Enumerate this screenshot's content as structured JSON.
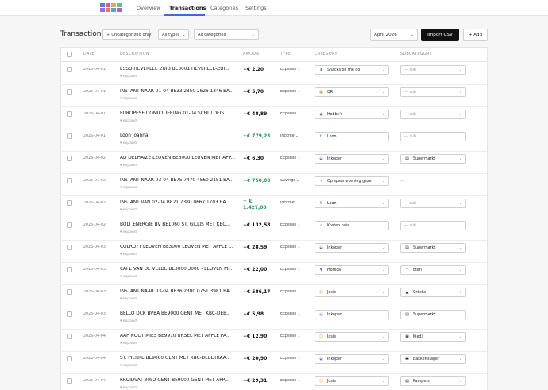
{
  "nav": {
    "logo_colors": [
      "#5b7be0",
      "#e05b7b",
      "#e0a95b",
      "#5bc08c",
      "#9b6be0",
      "#e07b5b",
      "#4aa8d8",
      "#c05bbd"
    ],
    "tabs": [
      {
        "label": "Overview",
        "active": false
      },
      {
        "label": "Transactions",
        "active": true
      },
      {
        "label": "Categories",
        "active": false
      },
      {
        "label": "Settings",
        "active": false
      }
    ]
  },
  "toolbar": {
    "title": "Transactions",
    "uncategorized_label": "Uncategorized only",
    "types_filter": "All types",
    "categories_filter": "All categories",
    "month": "April 2026",
    "import_label": "Import CSV",
    "add_label": "+ Add"
  },
  "table": {
    "headers": {
      "date": "DATE",
      "description": "DESCRIPTION",
      "amount": "AMOUNT",
      "type": "TYPE",
      "category": "CATEGORY",
      "subcategory": "SUBCATEGORY"
    },
    "expand_label": "expand",
    "rows": [
      {
        "date": "2026-04-01",
        "description": "ESSO HEVERLEE ZUID BE3001 HEVERLEE-ZUI...",
        "amount": "−€ 2,20",
        "kind": "expense",
        "type": "Expense",
        "category": "Snacks on the go",
        "category_icon": "bottle-icon",
        "subcategory": "— sub",
        "sub_icon": ""
      },
      {
        "date": "2026-04-01",
        "description": "INSTANT NAAR 01-04 BE33 2350 2626 1346 BA...",
        "amount": "−€ 5,70",
        "kind": "expense",
        "type": "Expense",
        "category": "QR",
        "category_icon": "qr-icon",
        "subcategory": "— sub",
        "sub_icon": ""
      },
      {
        "date": "2026-04-01",
        "description": "EUROPESE DOMICILIERING 01-04 SCHULDEIS...",
        "amount": "−€ 48,89",
        "kind": "expense",
        "type": "Expense",
        "category": "Hobby's",
        "category_icon": "palette-icon",
        "subcategory": "— sub",
        "sub_icon": ""
      },
      {
        "date": "2026-04-01",
        "description": "Loon Joanna",
        "amount": "+€ 779,23",
        "kind": "income",
        "type": "Income",
        "category": "Loon",
        "category_icon": "refresh-icon",
        "subcategory": "— sub",
        "sub_icon": ""
      },
      {
        "date": "2026-04-02",
        "description": "AD DELHAIZE LEUVEN BE3000 LEUVEN MET APP...",
        "amount": "−€ 6,30",
        "kind": "expense",
        "type": "Expense",
        "category": "Inkopen",
        "category_icon": "basket-icon",
        "subcategory": "Supermarkt",
        "sub_icon": "cart-icon"
      },
      {
        "date": "2026-04-02",
        "description": "INSTANT NAAR 03-04 BE75 7470 4560 2151 BA...",
        "amount": "−€ 750,00",
        "kind": "income",
        "type": "Savings",
        "category": "Op spaarrekening gezet",
        "category_icon": "double-chevron-up-icon",
        "subcategory": "—",
        "sub_icon": "",
        "no_sub_select": true
      },
      {
        "date": "2026-04-02",
        "description": "INSTANT VAN 02-04 BE21 7380 0667 1703 BA...",
        "amount": "+\n€ 1.427,00",
        "kind": "income",
        "wrap": true,
        "type": "Income",
        "category": "Loon",
        "category_icon": "refresh-icon",
        "subcategory": "— sub",
        "sub_icon": ""
      },
      {
        "date": "2026-04-02",
        "description": "BOLT ENERGIE BV BE1060 ST. GILLIS MET KBC...",
        "amount": "−€ 132,58",
        "kind": "expense",
        "type": "Expense",
        "category": "Kosten huis",
        "category_icon": "house-icon",
        "subcategory": "— sub",
        "sub_icon": ""
      },
      {
        "date": "2026-04-03",
        "description": "COLRUYT LEUVEN BE3000 LEUVEN MET APPLE ...",
        "amount": "−€ 28,59",
        "kind": "expense",
        "type": "Expense",
        "category": "Inkopen",
        "category_icon": "basket-icon",
        "subcategory": "Supermarkt",
        "sub_icon": "cart-icon"
      },
      {
        "date": "2026-04-03",
        "description": "CAFE VAN DE VELDE BE3000 3000 - LEUVEN M...",
        "amount": "−€ 22,00",
        "kind": "expense",
        "type": "Expense",
        "category": "Horeca",
        "category_icon": "glass-icon",
        "subcategory": "Eten",
        "sub_icon": "cutlery-icon"
      },
      {
        "date": "2026-04-03",
        "description": "INSTANT NAAR 03-04 BE36 2300 0751 3981 BA...",
        "amount": "−€ 586,17",
        "kind": "expense",
        "type": "Expense",
        "category": "Josie",
        "category_icon": "child-icon",
        "subcategory": "Crèche",
        "sub_icon": "school-icon"
      },
      {
        "date": "2026-04-03",
        "description": "BELLO DCK BVBA BE9000 GENT MET KBC-DEB...",
        "amount": "−€ 5,98",
        "kind": "expense",
        "type": "Expense",
        "category": "Inkopen",
        "category_icon": "basket-icon",
        "subcategory": "Supermarkt",
        "sub_icon": "cart-icon"
      },
      {
        "date": "2026-04-04",
        "description": "AAP NOOT MIES BE9910 URSEL MET APPLE PA...",
        "amount": "−€ 12,90",
        "kind": "expense",
        "type": "Expense",
        "category": "Josie",
        "category_icon": "child-icon",
        "subcategory": "Kledij",
        "sub_icon": "shirt-icon"
      },
      {
        "date": "2026-04-04",
        "description": "ST. PIERRE BE9000 GENT MET KBC-DEBETKAA...",
        "amount": "−€ 20,90",
        "kind": "expense",
        "type": "Expense",
        "category": "Inkopen",
        "category_icon": "basket-icon",
        "subcategory": "Bakker/slager",
        "sub_icon": "bread-icon"
      },
      {
        "date": "2026-04-04",
        "description": "KRUIDVAT 8052 GENT BE9000 GENT MET APP...",
        "amount": "−€ 29,31",
        "kind": "expense",
        "type": "Expense",
        "category": "Josie",
        "category_icon": "child-icon",
        "subcategory": "Pampers",
        "sub_icon": "cart-icon"
      }
    ]
  }
}
